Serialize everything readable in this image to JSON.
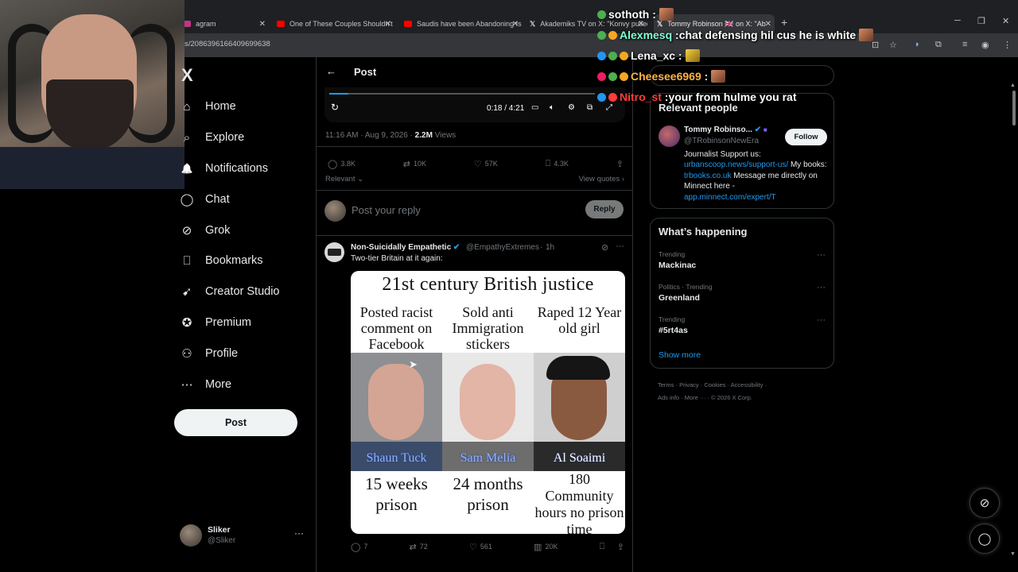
{
  "browser": {
    "tabs": [
      {
        "title": "agram",
        "fav_color": "#c13584"
      },
      {
        "title": "One of These Couples Shouldn't Be Toge",
        "fav_color": "#ff0000"
      },
      {
        "title": "Saudis have been Abandoning Islam",
        "fav_color": "#ff0000"
      },
      {
        "title": "Akademiks TV on X: \"Konvy pulled up on",
        "fav_color": "#ffffff"
      },
      {
        "title": "Tommy Robinson 🇬🇧 on X: \"Ab",
        "fav_color": "#ffffff"
      }
    ],
    "new_tab": "+",
    "url": "s/2086396166409699638"
  },
  "sidebar": {
    "logo": "X",
    "items": [
      {
        "label": "Home",
        "icon": "home-icon",
        "glyph": "⌂"
      },
      {
        "label": "Explore",
        "icon": "search-icon",
        "glyph": "⌕"
      },
      {
        "label": "Notifications",
        "icon": "bell-icon",
        "glyph": "🔔"
      },
      {
        "label": "Chat",
        "icon": "chat-icon",
        "glyph": "◯"
      },
      {
        "label": "Grok",
        "icon": "grok-icon",
        "glyph": "⊘"
      },
      {
        "label": "Bookmarks",
        "icon": "bookmark-icon",
        "glyph": "⎕"
      },
      {
        "label": "Creator Studio",
        "icon": "rocket-icon",
        "glyph": "➹"
      },
      {
        "label": "Premium",
        "icon": "premium-icon",
        "glyph": "✪"
      },
      {
        "label": "Profile",
        "icon": "profile-icon",
        "glyph": "⚇"
      },
      {
        "label": "More",
        "icon": "more-icon",
        "glyph": "⋯"
      }
    ],
    "post_button": "Post",
    "account": {
      "name": "Sliker",
      "handle": "@Sliker",
      "more": "···"
    }
  },
  "main": {
    "back": "←",
    "title": "Post",
    "video": {
      "progress": 0.071,
      "time": "0:18 / 4:21"
    },
    "meta": {
      "time": "11:16 AM · Aug 9, 2026 · ",
      "views_count": "2.2M",
      "views_label": " Views"
    },
    "actions": {
      "replies": "3.8K",
      "reposts": "10K",
      "likes": "57K",
      "bookmarks": "4.3K"
    },
    "sort": "Relevant ⌄",
    "view_quotes": "View quotes ›",
    "reply_placeholder": "Post your reply",
    "reply_button": "Reply",
    "tweet": {
      "name": "Non-Suicidally Empathetic",
      "verified": "✔",
      "handle": "@EmpathyExtremes",
      "dot": "·",
      "time": "1h",
      "text": "Two-tier Britain at it again:",
      "meme": {
        "title": "21st century British justice",
        "columns": [
          {
            "crime": "Posted racist comment on Facebook",
            "name": "Shaun Tuck",
            "sentence": "15 weeks prison"
          },
          {
            "crime": "Sold anti Immigration stickers",
            "name": "Sam Melia",
            "sentence": "24 months prison"
          },
          {
            "crime": "Raped 12 Year old girl",
            "name": "Al Soaimi",
            "sentence": "180 Community hours no prison time"
          }
        ]
      },
      "actions": {
        "replies": "7",
        "reposts": "72",
        "likes": "561",
        "views": "20K"
      }
    }
  },
  "right": {
    "relevant_title": "Relevant people",
    "person": {
      "name": "Tommy Robinso...",
      "handle": "@TRobinsonNewEra",
      "follow": "Follow",
      "bio_prefix": "Journalist Support us: ",
      "bio_link1": "urbanscoop.news/support-us/",
      "bio_mid": " My books: ",
      "bio_link2": "trbooks.co.uk",
      "bio_mid2": " Message me directly on Minnect here - ",
      "bio_link3": "app.minnect.com/expert/T"
    },
    "happening_title": "What’s happening",
    "trends": [
      {
        "category": "Trending",
        "name": "Mackinac"
      },
      {
        "category": "Politics · Trending",
        "name": "Greenland"
      },
      {
        "category": "Trending",
        "name": "#5rt4as"
      }
    ],
    "show_more": "Show more",
    "footer1": "Terms  ·  Privacy  ·  Cookies  ·  Accessibility  ·",
    "footer2": "Ads info  ·  More ···  ·  © 2026 X Corp."
  },
  "chat": [
    {
      "user": "sothoth",
      "message": "",
      "color": "#ffffff"
    },
    {
      "user": "Alexmesq",
      "message": " chat defensing hil cus he is white",
      "color": "#7fffd4"
    },
    {
      "user": "Lena_xc",
      "message": "",
      "color": "#ffffff"
    },
    {
      "user": "Cheesee6969",
      "message": "",
      "color": "#ffb347"
    },
    {
      "user": "Nitro_st",
      "message": " your from hulme you rat",
      "color": "#ff3b3b"
    }
  ]
}
